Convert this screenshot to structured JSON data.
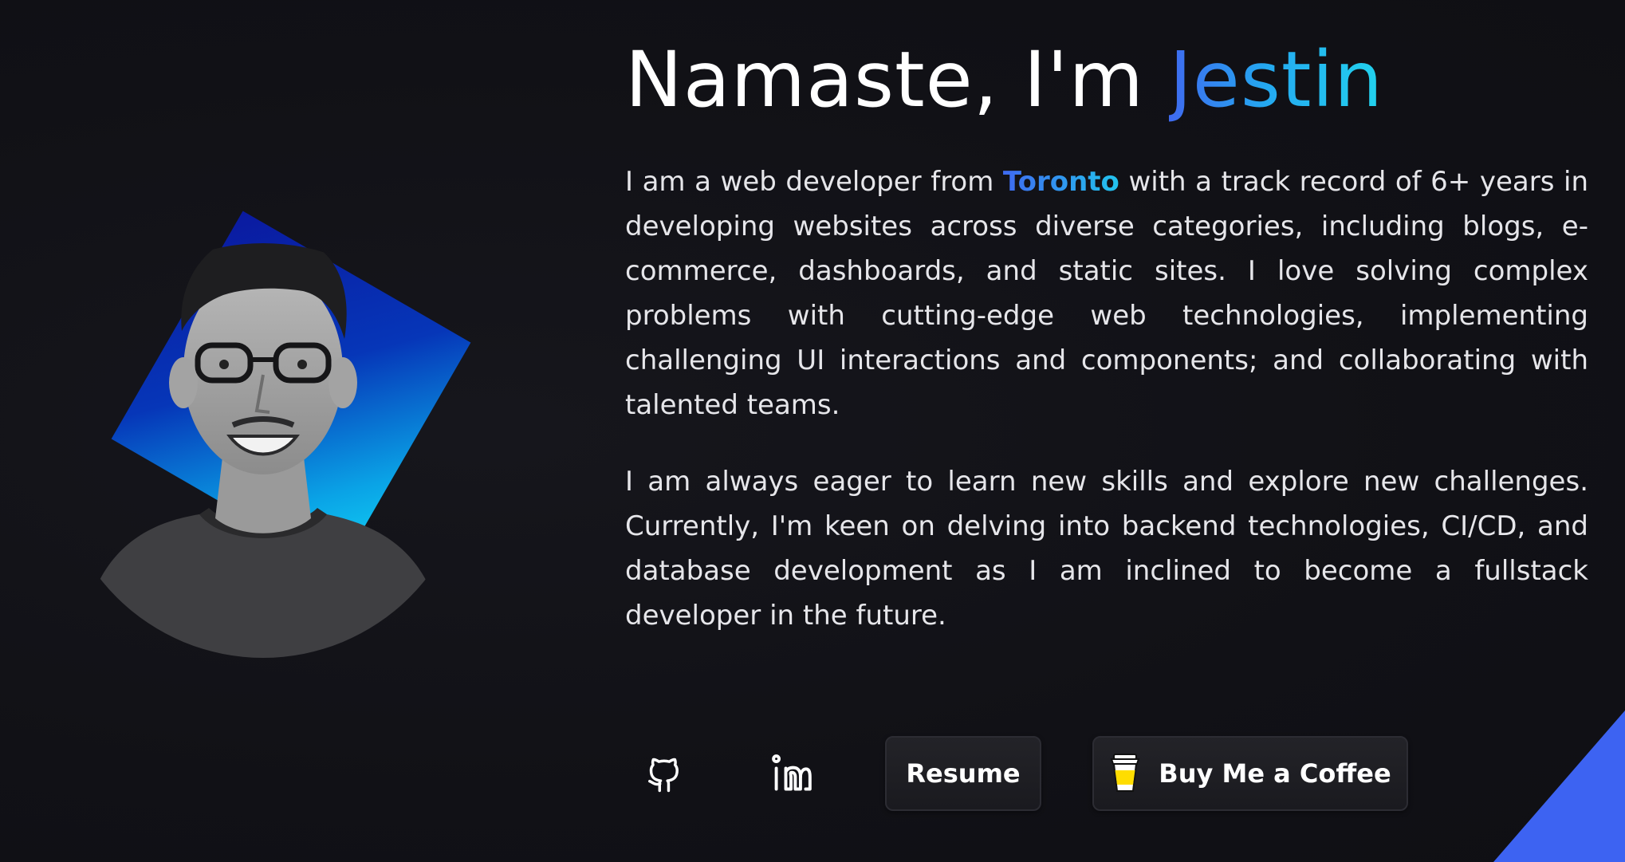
{
  "hero": {
    "greeting": "Namaste, I'm ",
    "name": "Jestin"
  },
  "about": {
    "p1_before": "I am a web developer from ",
    "p1_highlight": "Toronto",
    "p1_after": " with a track record of 6+ years in developing websites across diverse categories, including blogs, e-commerce, dashboards, and static sites. I love solving complex problems with cutting-edge web technologies, implementing challenging UI interactions and components; and collaborating with talented teams.",
    "p2": "I am always eager to learn new skills and explore new challenges. Currently, I'm keen on delving into backend technologies, CI/CD, and database development as I am inclined to become a fullstack developer in the future."
  },
  "actions": {
    "github_icon": "github-icon",
    "linkedin_icon": "linkedin-icon",
    "resume_label": "Resume",
    "coffee_label": "Buy Me a Coffee",
    "coffee_icon": "coffee-cup-icon"
  },
  "colors": {
    "background": "#111116",
    "accent_blue": "#3f6af0",
    "accent_cyan": "#22d3ee",
    "corner_accent": "#3d63f2"
  }
}
